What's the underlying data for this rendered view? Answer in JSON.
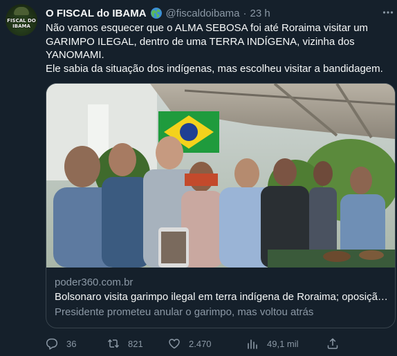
{
  "author": {
    "name": "O FISCAL do IBAMA",
    "handle": "@fiscaldoibama",
    "separator": "·",
    "time": "23 h",
    "avatar_text": "FISCAL DO IBAMA",
    "badge_icon": "globe-icon"
  },
  "tweet": {
    "paragraph1": "Não vamos esquecer que o ALMA SEBOSA foi até Roraima visitar um GARIMPO ILEGAL, dentro de uma TERRA INDÍGENA, vizinha dos YANOMAMI.",
    "paragraph2": "Ele sabia da situação dos indígenas, mas escolheu visitar a bandidagem."
  },
  "card": {
    "domain": "poder360.com.br",
    "title": "Bolsonaro visita garimpo ilegal em terra indígena de Roraima; oposição…",
    "description": "Presidente prometeu anular o garimpo, mas voltou atrás"
  },
  "actions": {
    "replies": "36",
    "retweets": "821",
    "likes": "2.470",
    "views": "49,1 mil"
  },
  "colors": {
    "background": "#15202b",
    "text": "#f7f9f9",
    "secondary": "#8b98a5",
    "border": "#38444d"
  }
}
